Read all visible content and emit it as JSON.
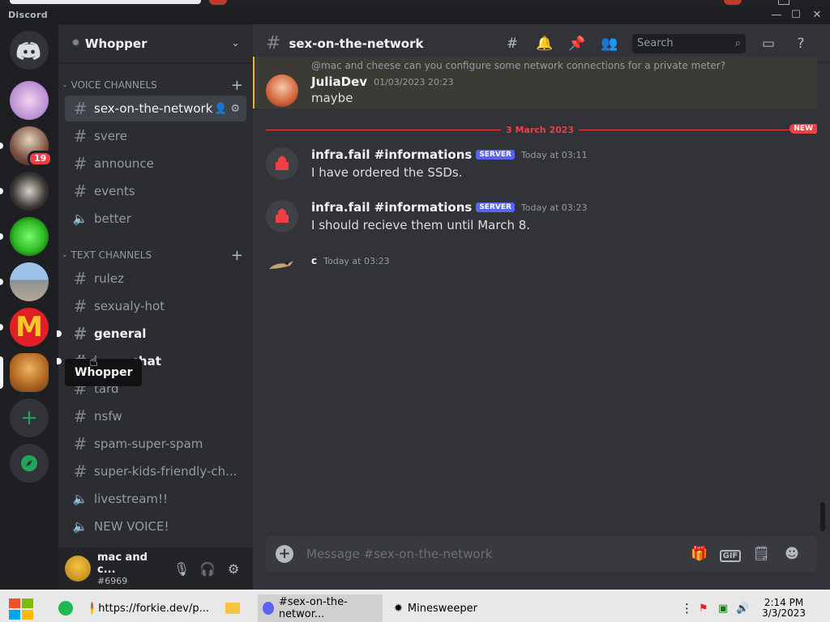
{
  "window": {
    "brand": "Discord"
  },
  "guilds": {
    "badge": "19"
  },
  "server": {
    "name": "Whopper"
  },
  "voice_category": {
    "label": "VOICE CHANNELS"
  },
  "text_category": {
    "label": "TEXT CHANNELS"
  },
  "channels": [
    {
      "name": "sex-on-the-network",
      "icon": "hash-icon",
      "state": "active"
    },
    {
      "name": "svere",
      "icon": "hash-icon"
    },
    {
      "name": "announce",
      "icon": "hash-icon"
    },
    {
      "name": "events",
      "icon": "hash-icon"
    },
    {
      "name": "better",
      "icon": "speaker-icon"
    },
    {
      "name": "rulez",
      "icon": "hash-icon"
    },
    {
      "name": "sexualy-hot",
      "icon": "hash-icon"
    },
    {
      "name": "general",
      "icon": "hash-icon",
      "state": "unread"
    },
    {
      "name": "chat",
      "icon": "hash-icon",
      "state": "unread"
    },
    {
      "name": "tard",
      "icon": "hash-icon"
    },
    {
      "name": "nsfw",
      "icon": "hash-icon"
    },
    {
      "name": "spam-super-spam",
      "icon": "hash-icon"
    },
    {
      "name": "super-kids-friendly-ch...",
      "icon": "hash-icon"
    },
    {
      "name": "livestream!!",
      "icon": "speaker-icon"
    },
    {
      "name": "NEW VOICE!",
      "icon": "speaker-icon"
    }
  ],
  "tooltip": "Whopper",
  "user": {
    "name": "mac and c...",
    "tag": "#6969"
  },
  "channel_header": {
    "name": "sex-on-the-network",
    "search_placeholder": "Search"
  },
  "reply_preview": "@mac and cheese  can you configure some network connections for a private meter?",
  "messages": [
    {
      "author": "JuliaDev",
      "time": "01/03/2023 20:23",
      "text": "maybe"
    },
    {
      "author": "infra.fail #informations",
      "badge": "SERVER",
      "time": "Today at 03:11",
      "text": "I have ordered the SSDs."
    },
    {
      "author": "infra.fail #informations",
      "badge": "SERVER",
      "time": "Today at 03:23",
      "text": "I should recieve them until March 8."
    },
    {
      "author": "c",
      "time": "Today at 03:23",
      "text": ""
    }
  ],
  "divider": {
    "date": "3 March 2023",
    "new_label": "NEW"
  },
  "composer": {
    "placeholder": "Message #sex-on-the-network"
  },
  "taskbar": {
    "items": [
      "https://forkie.dev/p...",
      "#sex-on-the-networ...",
      "Minesweeper"
    ],
    "time": "2:14 PM",
    "date": "3/3/2023"
  },
  "colors": {
    "blurple": "#5865f2",
    "red": "#f23f43",
    "mention": "#f0b232"
  }
}
